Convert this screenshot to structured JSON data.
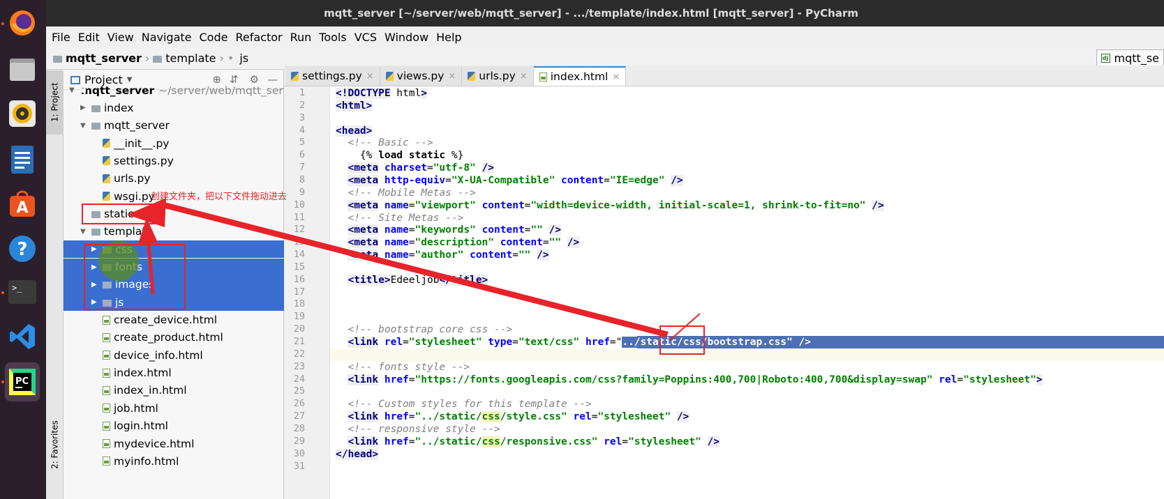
{
  "window": {
    "title": "mqtt_server [~/server/web/mqtt_server] - .../template/index.html [mqtt_server] - PyCharm"
  },
  "menu": [
    "File",
    "Edit",
    "View",
    "Navigate",
    "Code",
    "Refactor",
    "Run",
    "Tools",
    "VCS",
    "Window",
    "Help"
  ],
  "breadcrumb": {
    "root": "mqtt_server",
    "folder": "template",
    "leaf": "js",
    "run_config": "mqtt_se"
  },
  "side_tabs": {
    "project": "1: Project",
    "favorites": "2: Favorites"
  },
  "project_panel": {
    "title": "Project"
  },
  "tree": [
    {
      "label": "mqtt_server",
      "hint": "~/server/web/mqtt_server",
      "icon": "module",
      "expand": "open"
    },
    {
      "label": "index",
      "icon": "folder",
      "expand": "closed"
    },
    {
      "label": "mqtt_server",
      "icon": "folder",
      "expand": "open"
    },
    {
      "label": "__init__.py",
      "icon": "python-file"
    },
    {
      "label": "settings.py",
      "icon": "python-file"
    },
    {
      "label": "urls.py",
      "icon": "python-file"
    },
    {
      "label": "wsgi.py",
      "icon": "python-file"
    },
    {
      "label": "static",
      "icon": "folder"
    },
    {
      "label": "template",
      "icon": "folder",
      "expand": "open"
    },
    {
      "label": "css",
      "icon": "folder",
      "expand": "closed",
      "selected": true
    },
    {
      "label": "fonts",
      "icon": "folder",
      "expand": "closed",
      "selected": true
    },
    {
      "label": "images",
      "icon": "folder",
      "expand": "closed",
      "selected": true
    },
    {
      "label": "js",
      "icon": "folder",
      "expand": "closed",
      "selected": true
    },
    {
      "label": "create_device.html",
      "icon": "html-file"
    },
    {
      "label": "create_product.html",
      "icon": "html-file"
    },
    {
      "label": "device_info.html",
      "icon": "html-file"
    },
    {
      "label": "index.html",
      "icon": "html-file"
    },
    {
      "label": "index_in.html",
      "icon": "html-file"
    },
    {
      "label": "job.html",
      "icon": "html-file"
    },
    {
      "label": "login.html",
      "icon": "html-file"
    },
    {
      "label": "mydevice.html",
      "icon": "html-file"
    },
    {
      "label": "myinfo.html",
      "icon": "html-file"
    }
  ],
  "tabs": [
    {
      "label": "settings.py",
      "active": false
    },
    {
      "label": "views.py",
      "active": false
    },
    {
      "label": "urls.py",
      "active": false
    },
    {
      "label": "index.html",
      "active": true
    }
  ],
  "annotation": {
    "note": "创建文件夹，把以下文件拖动进去"
  },
  "code_lines": [
    "<!DOCTYPE html>",
    "<html>",
    "",
    "<head>",
    "  <!-- Basic -->",
    "    {% load static %}",
    "  <meta charset=\"utf-8\" />",
    "  <meta http-equiv=\"X-UA-Compatible\" content=\"IE=edge\" />",
    "  <!-- Mobile Metas -->",
    "  <meta name=\"viewport\" content=\"width=device-width, initial-scale=1, shrink-to-fit=no\" />",
    "  <!-- Site Metas -->",
    "  <meta name=\"keywords\" content=\"\" />",
    "  <meta name=\"description\" content=\"\" />",
    "  <meta name=\"author\" content=\"\" />",
    "",
    "  <title>Edeeljob</title>",
    "",
    "",
    "",
    "  <!-- bootstrap core css -->",
    "  <link rel=\"stylesheet\" type=\"text/css\" href=\"../static/css/bootstrap.css\" />",
    "",
    "  <!-- fonts style -->",
    "  <link href=\"https://fonts.googleapis.com/css?family=Poppins:400,700|Roboto:400,700&display=swap\" rel=\"stylesheet\">",
    "",
    "  <!-- Custom styles for this template -->",
    "  <link href=\"../static/css/style.css\" rel=\"stylesheet\" />",
    "  <!-- responsive style -->",
    "  <link href=\"../static/css/responsive.css\" rel=\"stylesheet\" />",
    "</head>",
    ""
  ],
  "colors": {
    "selection": "#3a6ed1",
    "annotation": "#e8232a",
    "dock": "#2c1f2c"
  }
}
